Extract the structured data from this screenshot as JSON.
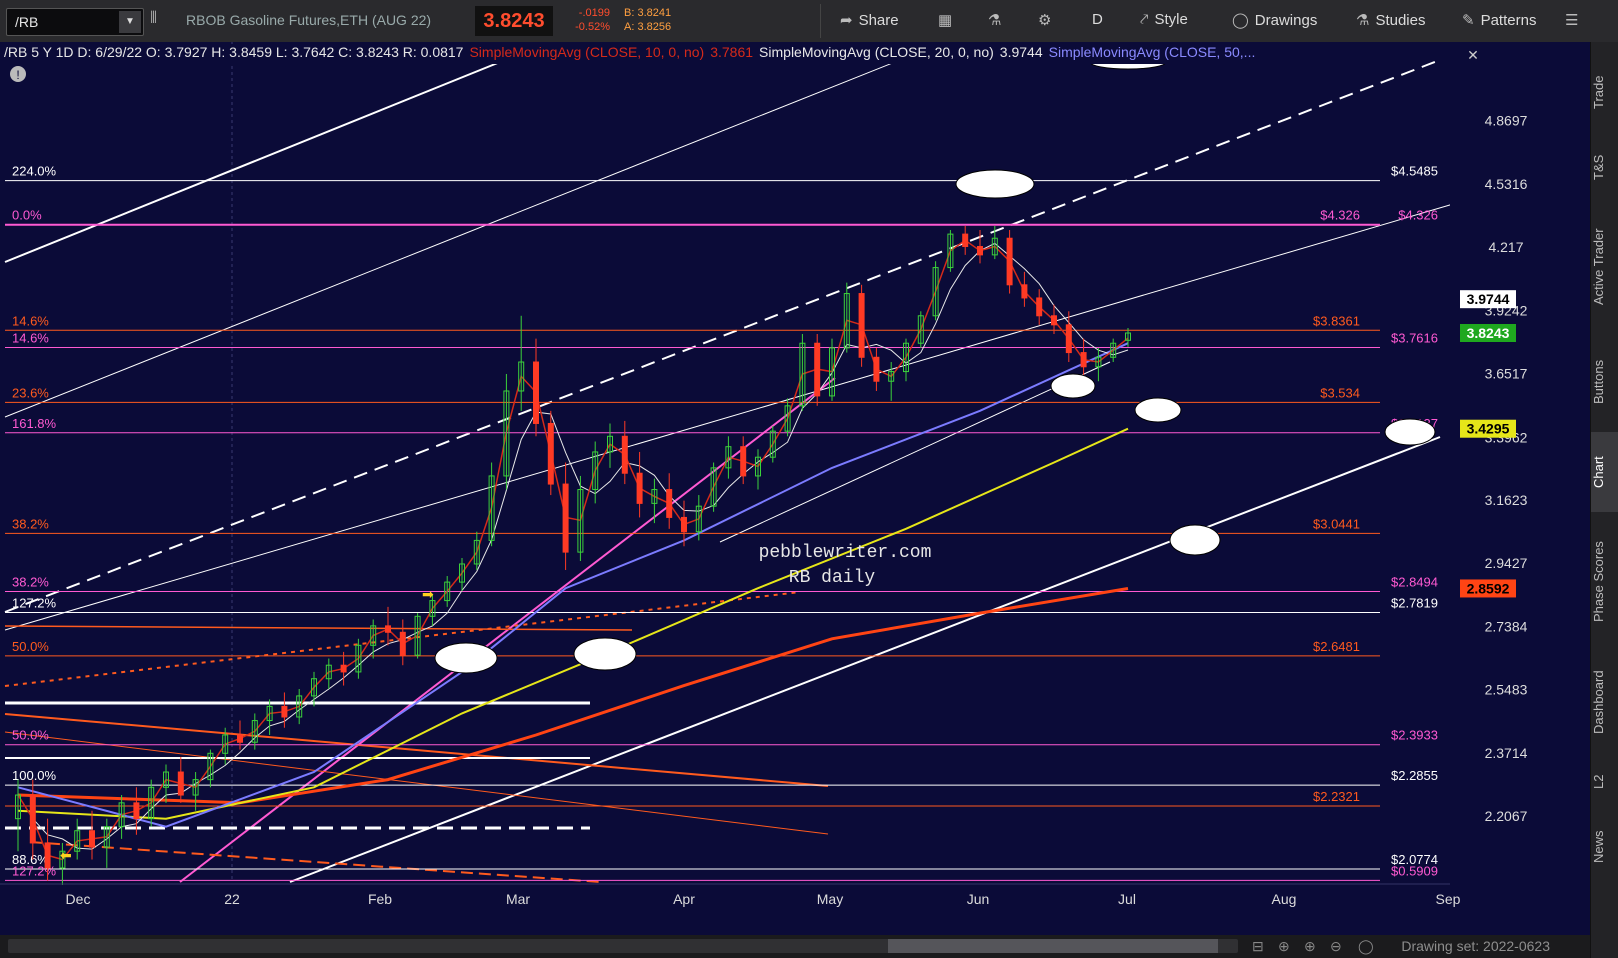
{
  "toolbar": {
    "symbol": "/RB",
    "description": "RBOB Gasoline Futures,ETH (AUG 22)",
    "last": "3.8243",
    "change": "-.0199",
    "change_pct": "-0.52%",
    "bid": "B: 3.8241",
    "ask": "A: 3.8256",
    "share": "Share",
    "period": "D",
    "style": "Style",
    "drawings": "Drawings",
    "studies": "Studies",
    "patterns": "Patterns"
  },
  "header": {
    "info": "/RB 5 Y 1D  D: 6/29/22  O: 3.7927  H: 3.8459  L: 3.7642  C: 3.8243  R: 0.0817",
    "sma10": "SimpleMovingAvg (CLOSE, 10, 0, no)",
    "sma10_val": "3.7861",
    "sma20": "SimpleMovingAvg (CLOSE, 20, 0, no)",
    "sma20_val": "3.9744",
    "sma50": "SimpleMovingAvg (CLOSE, 50,..."
  },
  "right_tabs": [
    "Trade",
    "T&S",
    "Active Trader",
    "Buttons",
    "Chart",
    "Phase Scores",
    "Dashboard",
    "L2",
    "News"
  ],
  "active_tab": "Chart",
  "bottom": {
    "drawing_set": "Drawing set: 2022-0623"
  },
  "watermark": [
    "pebblewriter.com",
    "RB daily"
  ],
  "colors": {
    "background": "#0b0b38",
    "up": "#3bd23b",
    "down": "#ff3a24",
    "sma10": "#d42a1a",
    "sma20": "#e8e8e8",
    "sma50": "#7b7bff",
    "sma100": "#e6e619",
    "sma200": "#ff4414",
    "fib_orange": "#ff5a1e",
    "fib_pink": "#ff5ad2",
    "white": "#ffffff"
  },
  "chart_data": {
    "type": "candlestick",
    "ylim": [
      2.0,
      5.0
    ],
    "x_labels": [
      "Dec",
      "22",
      "Feb",
      "Mar",
      "Apr",
      "May",
      "Jun",
      "Jul",
      "Aug",
      "Sep"
    ],
    "y_ticks": [
      "4.8697",
      "4.5316",
      "4.217",
      "3.9242",
      "3.6517",
      "3.3962",
      "3.1623",
      "2.9427",
      "2.7384",
      "2.5483",
      "2.3714",
      "2.2067"
    ],
    "price_badges": [
      {
        "text": "3.9744",
        "value": 3.9744,
        "style": "white"
      },
      {
        "text": "3.8243",
        "value": 3.8243,
        "style": "green"
      },
      {
        "text": "3.4295",
        "value": 3.4295,
        "style": "yellow"
      },
      {
        "text": "2.8592",
        "value": 2.8592,
        "style": "orange"
      }
    ],
    "hlines": [
      {
        "value": 4.5485,
        "color": "white",
        "left": "224.0%",
        "right": "$4.5485"
      },
      {
        "value": 4.326,
        "color": "pink",
        "left": "0.0%",
        "mid": "$4.326",
        "right": "$4.326"
      },
      {
        "value": 3.8361,
        "color": "orange",
        "left": "14.6%",
        "mid": "$3.8361"
      },
      {
        "value": 3.7616,
        "color": "pink",
        "left": "14.6%",
        "right": "$3.7616"
      },
      {
        "value": 3.534,
        "color": "orange",
        "left": "23.6%",
        "mid": "$3.534"
      },
      {
        "value": 3.4137,
        "color": "pink",
        "left": "161.8%",
        "right": "$3.4137"
      },
      {
        "value": 3.0441,
        "color": "orange",
        "left": "38.2%",
        "mid": "$3.0441"
      },
      {
        "value": 2.8494,
        "color": "pink",
        "left": "38.2%",
        "right": "$2.8494"
      },
      {
        "value": 2.7819,
        "color": "white",
        "left": "127.2%",
        "right": "$2.7819"
      },
      {
        "value": 2.6481,
        "color": "orange",
        "left": "50.0%",
        "mid": "$2.6481"
      },
      {
        "value": 2.3933,
        "color": "pink",
        "left": "50.0%",
        "right": "$2.3933"
      },
      {
        "value": 2.2855,
        "color": "white",
        "left": "100.0%",
        "right": "$2.2855"
      },
      {
        "value": 2.2321,
        "color": "orange",
        "left": "",
        "mid": "$2.2321"
      },
      {
        "value": 2.0774,
        "color": "white",
        "left": "88.6%",
        "right": "$2.0774"
      },
      {
        "value": 2.0509,
        "color": "pink",
        "left": "127.2%",
        "right": "$0.5909"
      }
    ],
    "candles": [
      {
        "d": 0,
        "o": 2.2,
        "h": 2.3,
        "l": 2.12,
        "c": 2.26
      },
      {
        "d": 2,
        "o": 2.26,
        "h": 2.3,
        "l": 2.1,
        "c": 2.14
      },
      {
        "d": 4,
        "o": 2.14,
        "h": 2.2,
        "l": 2.05,
        "c": 2.08
      },
      {
        "d": 6,
        "o": 2.08,
        "h": 2.14,
        "l": 2.04,
        "c": 2.12
      },
      {
        "d": 8,
        "o": 2.12,
        "h": 2.2,
        "l": 2.1,
        "c": 2.17
      },
      {
        "d": 10,
        "o": 2.17,
        "h": 2.22,
        "l": 2.1,
        "c": 2.13
      },
      {
        "d": 12,
        "o": 2.13,
        "h": 2.2,
        "l": 2.08,
        "c": 2.18
      },
      {
        "d": 14,
        "o": 2.18,
        "h": 2.26,
        "l": 2.15,
        "c": 2.24
      },
      {
        "d": 16,
        "o": 2.24,
        "h": 2.28,
        "l": 2.16,
        "c": 2.2
      },
      {
        "d": 18,
        "o": 2.2,
        "h": 2.3,
        "l": 2.18,
        "c": 2.28
      },
      {
        "d": 20,
        "o": 2.28,
        "h": 2.34,
        "l": 2.24,
        "c": 2.32
      },
      {
        "d": 22,
        "o": 2.32,
        "h": 2.36,
        "l": 2.24,
        "c": 2.26
      },
      {
        "d": 24,
        "o": 2.26,
        "h": 2.32,
        "l": 2.22,
        "c": 2.3
      },
      {
        "d": 26,
        "o": 2.3,
        "h": 2.38,
        "l": 2.28,
        "c": 2.37
      },
      {
        "d": 28,
        "o": 2.37,
        "h": 2.44,
        "l": 2.34,
        "c": 2.42
      },
      {
        "d": 30,
        "o": 2.42,
        "h": 2.46,
        "l": 2.38,
        "c": 2.4
      },
      {
        "d": 32,
        "o": 2.4,
        "h": 2.48,
        "l": 2.38,
        "c": 2.46
      },
      {
        "d": 34,
        "o": 2.46,
        "h": 2.52,
        "l": 2.42,
        "c": 2.5
      },
      {
        "d": 36,
        "o": 2.5,
        "h": 2.54,
        "l": 2.44,
        "c": 2.47
      },
      {
        "d": 38,
        "o": 2.47,
        "h": 2.55,
        "l": 2.45,
        "c": 2.53
      },
      {
        "d": 40,
        "o": 2.53,
        "h": 2.6,
        "l": 2.5,
        "c": 2.58
      },
      {
        "d": 42,
        "o": 2.58,
        "h": 2.64,
        "l": 2.55,
        "c": 2.62
      },
      {
        "d": 44,
        "o": 2.62,
        "h": 2.66,
        "l": 2.56,
        "c": 2.6
      },
      {
        "d": 46,
        "o": 2.6,
        "h": 2.7,
        "l": 2.58,
        "c": 2.68
      },
      {
        "d": 48,
        "o": 2.68,
        "h": 2.76,
        "l": 2.64,
        "c": 2.74
      },
      {
        "d": 50,
        "o": 2.74,
        "h": 2.8,
        "l": 2.68,
        "c": 2.72
      },
      {
        "d": 52,
        "o": 2.72,
        "h": 2.76,
        "l": 2.62,
        "c": 2.65
      },
      {
        "d": 54,
        "o": 2.65,
        "h": 2.78,
        "l": 2.64,
        "c": 2.77
      },
      {
        "d": 56,
        "o": 2.77,
        "h": 2.84,
        "l": 2.74,
        "c": 2.82
      },
      {
        "d": 58,
        "o": 2.82,
        "h": 2.9,
        "l": 2.8,
        "c": 2.88
      },
      {
        "d": 60,
        "o": 2.88,
        "h": 2.96,
        "l": 2.85,
        "c": 2.94
      },
      {
        "d": 62,
        "o": 2.94,
        "h": 3.05,
        "l": 2.92,
        "c": 3.02
      },
      {
        "d": 64,
        "o": 3.02,
        "h": 3.3,
        "l": 3.0,
        "c": 3.25
      },
      {
        "d": 66,
        "o": 3.25,
        "h": 3.65,
        "l": 3.2,
        "c": 3.58
      },
      {
        "d": 68,
        "o": 3.58,
        "h": 3.9,
        "l": 3.5,
        "c": 3.7
      },
      {
        "d": 70,
        "o": 3.7,
        "h": 3.8,
        "l": 3.4,
        "c": 3.45
      },
      {
        "d": 72,
        "o": 3.45,
        "h": 3.5,
        "l": 3.18,
        "c": 3.22
      },
      {
        "d": 74,
        "o": 3.22,
        "h": 3.3,
        "l": 2.92,
        "c": 2.98
      },
      {
        "d": 76,
        "o": 2.98,
        "h": 3.25,
        "l": 2.95,
        "c": 3.2
      },
      {
        "d": 78,
        "o": 3.2,
        "h": 3.38,
        "l": 3.15,
        "c": 3.34
      },
      {
        "d": 80,
        "o": 3.34,
        "h": 3.45,
        "l": 3.28,
        "c": 3.4
      },
      {
        "d": 82,
        "o": 3.4,
        "h": 3.46,
        "l": 3.22,
        "c": 3.26
      },
      {
        "d": 84,
        "o": 3.26,
        "h": 3.34,
        "l": 3.1,
        "c": 3.15
      },
      {
        "d": 86,
        "o": 3.15,
        "h": 3.24,
        "l": 3.08,
        "c": 3.2
      },
      {
        "d": 88,
        "o": 3.2,
        "h": 3.26,
        "l": 3.06,
        "c": 3.1
      },
      {
        "d": 90,
        "o": 3.1,
        "h": 3.16,
        "l": 3.0,
        "c": 3.05
      },
      {
        "d": 92,
        "o": 3.05,
        "h": 3.18,
        "l": 3.02,
        "c": 3.14
      },
      {
        "d": 94,
        "o": 3.14,
        "h": 3.3,
        "l": 3.12,
        "c": 3.28
      },
      {
        "d": 96,
        "o": 3.28,
        "h": 3.4,
        "l": 3.24,
        "c": 3.36
      },
      {
        "d": 98,
        "o": 3.36,
        "h": 3.4,
        "l": 3.22,
        "c": 3.25
      },
      {
        "d": 100,
        "o": 3.25,
        "h": 3.35,
        "l": 3.2,
        "c": 3.32
      },
      {
        "d": 102,
        "o": 3.32,
        "h": 3.44,
        "l": 3.3,
        "c": 3.42
      },
      {
        "d": 104,
        "o": 3.42,
        "h": 3.55,
        "l": 3.4,
        "c": 3.52
      },
      {
        "d": 106,
        "o": 3.52,
        "h": 3.82,
        "l": 3.5,
        "c": 3.78
      },
      {
        "d": 108,
        "o": 3.78,
        "h": 3.82,
        "l": 3.52,
        "c": 3.56
      },
      {
        "d": 110,
        "o": 3.56,
        "h": 3.8,
        "l": 3.54,
        "c": 3.76
      },
      {
        "d": 112,
        "o": 3.76,
        "h": 4.05,
        "l": 3.74,
        "c": 4.0
      },
      {
        "d": 114,
        "o": 4.0,
        "h": 4.04,
        "l": 3.68,
        "c": 3.72
      },
      {
        "d": 116,
        "o": 3.72,
        "h": 3.76,
        "l": 3.58,
        "c": 3.62
      },
      {
        "d": 118,
        "o": 3.62,
        "h": 3.7,
        "l": 3.54,
        "c": 3.66
      },
      {
        "d": 120,
        "o": 3.66,
        "h": 3.8,
        "l": 3.62,
        "c": 3.78
      },
      {
        "d": 122,
        "o": 3.78,
        "h": 3.92,
        "l": 3.76,
        "c": 3.9
      },
      {
        "d": 124,
        "o": 3.9,
        "h": 4.15,
        "l": 3.88,
        "c": 4.12
      },
      {
        "d": 126,
        "o": 4.12,
        "h": 4.3,
        "l": 4.1,
        "c": 4.28
      },
      {
        "d": 128,
        "o": 4.28,
        "h": 4.32,
        "l": 4.18,
        "c": 4.22
      },
      {
        "d": 130,
        "o": 4.22,
        "h": 4.3,
        "l": 4.14,
        "c": 4.18
      },
      {
        "d": 132,
        "o": 4.18,
        "h": 4.32,
        "l": 4.16,
        "c": 4.26
      },
      {
        "d": 134,
        "o": 4.26,
        "h": 4.3,
        "l": 4.0,
        "c": 4.04
      },
      {
        "d": 136,
        "o": 4.04,
        "h": 4.1,
        "l": 3.94,
        "c": 3.98
      },
      {
        "d": 138,
        "o": 3.98,
        "h": 4.02,
        "l": 3.86,
        "c": 3.9
      },
      {
        "d": 140,
        "o": 3.9,
        "h": 3.95,
        "l": 3.82,
        "c": 3.86
      },
      {
        "d": 142,
        "o": 3.86,
        "h": 3.92,
        "l": 3.7,
        "c": 3.74
      },
      {
        "d": 144,
        "o": 3.74,
        "h": 3.8,
        "l": 3.64,
        "c": 3.68
      },
      {
        "d": 146,
        "o": 3.68,
        "h": 3.76,
        "l": 3.62,
        "c": 3.72
      },
      {
        "d": 148,
        "o": 3.72,
        "h": 3.8,
        "l": 3.7,
        "c": 3.78
      },
      {
        "d": 150,
        "o": 3.7927,
        "h": 3.8459,
        "l": 3.7642,
        "c": 3.8243
      }
    ]
  }
}
